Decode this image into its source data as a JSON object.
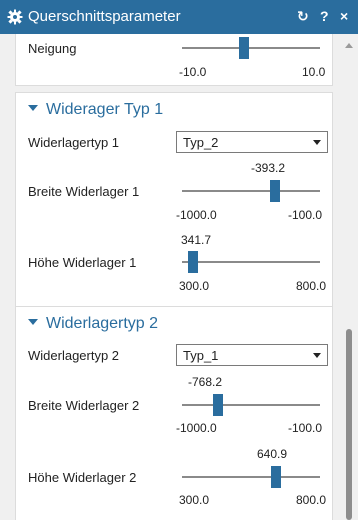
{
  "title": "Querschnittsparameter",
  "title_icons": {
    "refresh": "↻",
    "help": "?",
    "close": "×"
  },
  "neigung": {
    "label": "Neigung",
    "min": "-10.0",
    "max": "10.0",
    "level": 0.45
  },
  "section1": {
    "heading": "Widerager Typ 1",
    "type_label": "Widerlagertyp 1",
    "type_value": "Typ_2",
    "breite": {
      "label": "Breite Widerlager 1",
      "value": "-393.2",
      "min": "-1000.0",
      "max": "-100.0",
      "level": 0.674
    },
    "hoehe": {
      "label": "Höhe Widerlager 1",
      "value": "341.7",
      "min": "300.0",
      "max": "800.0",
      "level": 0.083
    }
  },
  "section2": {
    "heading": "Widerlagertyp 2",
    "type_label": "Widerlagertyp 2",
    "type_value": "Typ_1",
    "breite": {
      "label": "Breite Widerlager 2",
      "value": "-768.2",
      "min": "-1000.0",
      "max": "-100.0",
      "level": 0.258
    },
    "hoehe": {
      "label": "Höhe Widerlager 2",
      "value": "640.9",
      "min": "300.0",
      "max": "800.0",
      "level": 0.682
    }
  },
  "colors": {
    "accent": "#2a6d9e",
    "track": "#8a8a8a",
    "panel": "#ffffff",
    "background": "#f0f0f0"
  }
}
